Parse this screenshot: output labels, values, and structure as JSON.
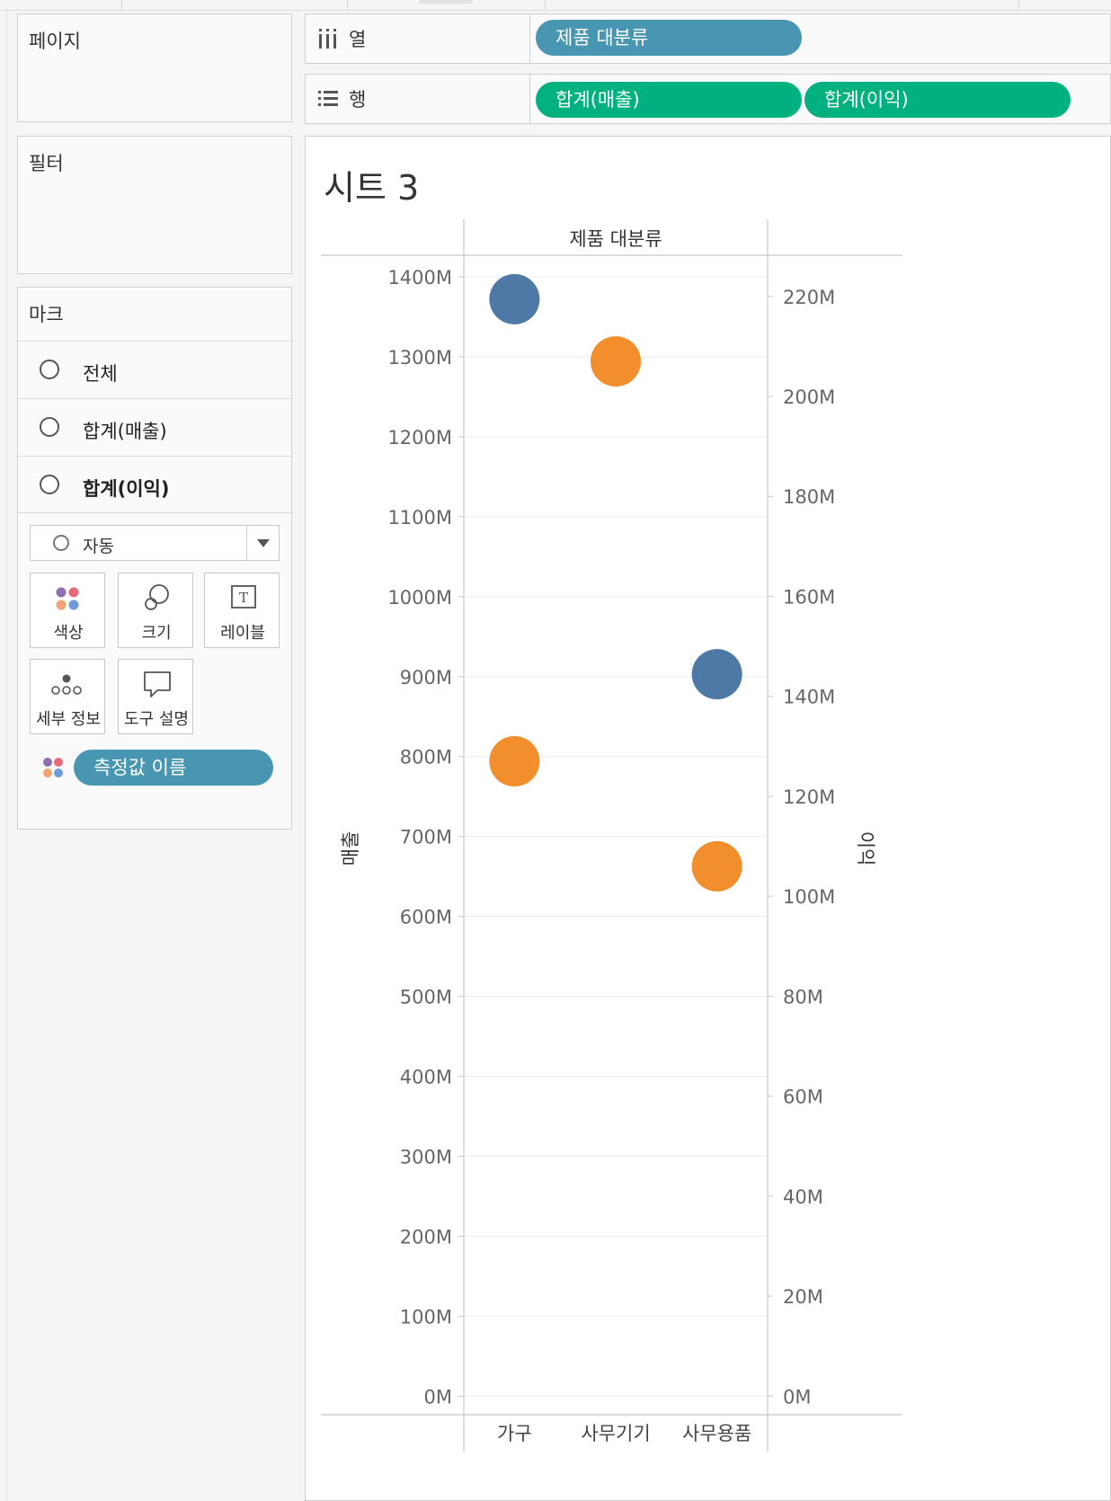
{
  "panels": {
    "pages_title": "페이지",
    "filters_title": "필터",
    "marks_title": "마크"
  },
  "marks": {
    "rows": [
      {
        "label": "전체",
        "bold": false
      },
      {
        "label": "합계(매출)",
        "bold": false
      },
      {
        "label": "합계(이익)",
        "bold": true
      }
    ],
    "mark_type": "자동",
    "buttons": [
      {
        "label": "색상",
        "icon": "color-icon"
      },
      {
        "label": "크기",
        "icon": "size-icon"
      },
      {
        "label": "레이블",
        "icon": "label-icon"
      },
      {
        "label": "세부 정보",
        "icon": "detail-icon"
      },
      {
        "label": "도구 설명",
        "icon": "tooltip-icon"
      }
    ],
    "color_field": "측정값 이름"
  },
  "shelves": {
    "columns_label": "열",
    "rows_label": "행",
    "columns_pill": "제품 대분류",
    "rows_pills": [
      "합계(매출)",
      "합계(이익)"
    ]
  },
  "sheet_title": "시트 3",
  "colors": {
    "series_sales": "#4e79a7",
    "series_profit": "#f28e2b",
    "pill_dimension": "#4996b2",
    "pill_measure": "#00b180",
    "mark_color_dots": [
      "#8f6fb0",
      "#e8687c",
      "#f2a371",
      "#6f9ad9"
    ]
  },
  "chart_data": {
    "type": "scatter",
    "title": "",
    "column_header": "제품 대분류",
    "categories": [
      "가구",
      "사무기기",
      "사무용품"
    ],
    "ylabel_left": "매출",
    "ylabel_right": "이익",
    "y_left": {
      "lim": [
        0,
        1440
      ],
      "ticks": [
        0,
        100,
        200,
        300,
        400,
        500,
        600,
        700,
        800,
        900,
        1000,
        1100,
        1200,
        1300,
        1400
      ],
      "tick_labels": [
        "0M",
        "100M",
        "200M",
        "300M",
        "400M",
        "500M",
        "600M",
        "700M",
        "800M",
        "900M",
        "1000M",
        "1100M",
        "1200M",
        "1300M",
        "1400M"
      ]
    },
    "y_right": {
      "lim": [
        0,
        224
      ],
      "ticks": [
        0,
        20,
        40,
        60,
        80,
        100,
        120,
        140,
        160,
        180,
        200,
        220
      ],
      "tick_labels": [
        "0M",
        "20M",
        "40M",
        "60M",
        "80M",
        "100M",
        "120M",
        "140M",
        "160M",
        "180M",
        "200M",
        "220M"
      ]
    },
    "series": [
      {
        "measure": "합계(매출)",
        "axis": "left",
        "color": "#4e79a7",
        "values": [
          1372,
          null,
          903
        ]
      },
      {
        "measure": "합계(이익)",
        "axis": "right",
        "color": "#f28e2b",
        "values": [
          127,
          207,
          106
        ]
      }
    ],
    "grid": true
  }
}
